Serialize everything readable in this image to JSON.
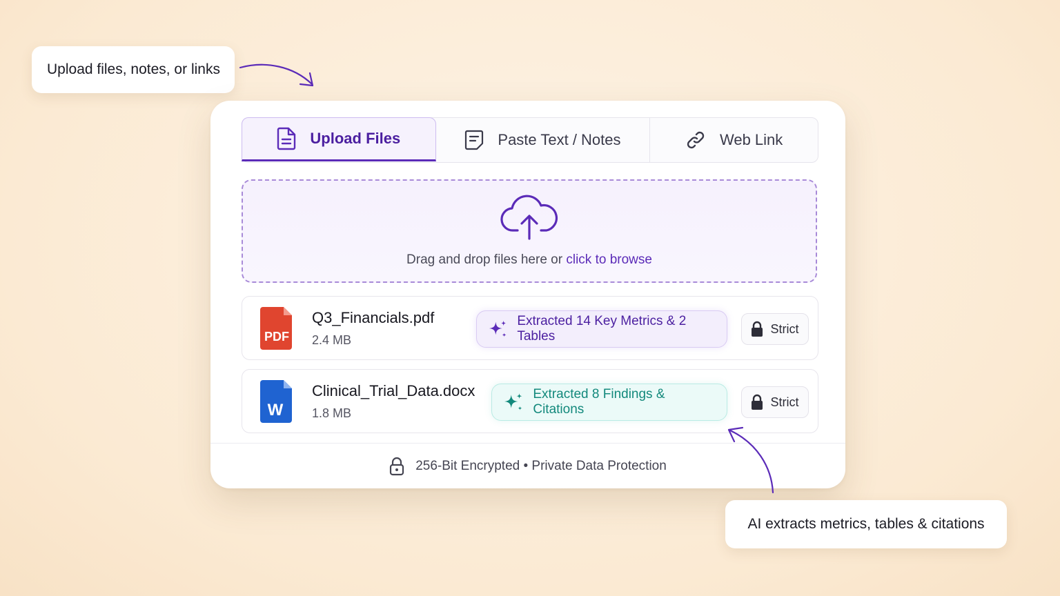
{
  "callouts": {
    "top": "Upload files, notes, or links",
    "bottom": "AI extracts metrics, tables & citations"
  },
  "tabs": [
    {
      "label": "Upload Files",
      "icon": "document-icon",
      "active": true
    },
    {
      "label": "Paste Text / Notes",
      "icon": "note-icon",
      "active": false
    },
    {
      "label": "Web Link",
      "icon": "link-icon",
      "active": false
    }
  ],
  "dropzone": {
    "text": "Drag and drop files here or",
    "link": "click to browse",
    "icon": "cloud-upload-icon"
  },
  "files": [
    {
      "name": "Q3_Financials.pdf",
      "size": "2.4 MB",
      "type_label": "PDF",
      "badge": "Extracted 14 Key Metrics & 2 Tables",
      "badge_color": "#4b1fa0",
      "lock_label": "Strict"
    },
    {
      "name": "Clinical_Trial_Data.docx",
      "size": "1.8 MB",
      "type_label": "W",
      "badge": "Extracted 8 Findings & Citations",
      "badge_color": "#13897c",
      "lock_label": "Strict"
    }
  ],
  "footer": {
    "text": "256-Bit Encrypted • Private Data Protection",
    "icon": "lock-icon"
  },
  "colors": {
    "accent": "#5b2bb8",
    "teal": "#13897c",
    "pdf": "#e0452f",
    "word": "#1f63d1",
    "background": "#fbead3"
  }
}
